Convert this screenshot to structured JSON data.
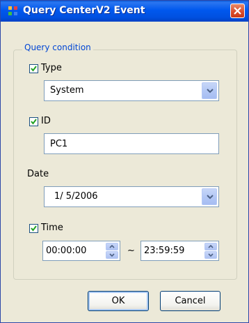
{
  "window": {
    "title": "Query CenterV2 Event"
  },
  "group": {
    "legend": "Query condition"
  },
  "type": {
    "label": "Type",
    "checked": true,
    "selected": "System"
  },
  "id": {
    "label": "ID",
    "checked": true,
    "value": "PC1"
  },
  "date": {
    "label": "Date",
    "selected": "1/ 5/2006"
  },
  "time": {
    "label": "Time",
    "checked": true,
    "start": "00:00:00",
    "separator": "~",
    "end": "23:59:59"
  },
  "buttons": {
    "ok": "OK",
    "cancel": "Cancel"
  },
  "colors": {
    "titlebar": "#0058ee",
    "legend": "#0046d5",
    "close": "#d84a2a"
  }
}
